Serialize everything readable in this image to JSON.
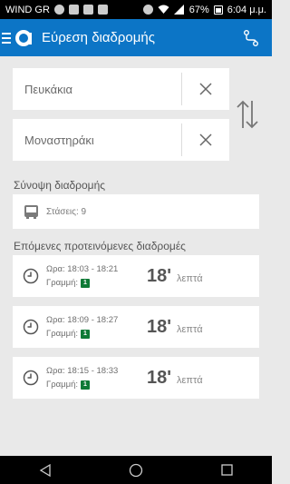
{
  "status_bar": {
    "carrier": "WIND GR",
    "battery": "67%",
    "time": "6:04 μ.μ."
  },
  "appbar": {
    "title": "Εύρεση διαδρομής"
  },
  "from_input": {
    "value": "Πευκάκια"
  },
  "to_input": {
    "value": "Μοναστηράκι"
  },
  "summary": {
    "title": "Σύνοψη διαδρομής",
    "stops": "Στάσεις: 9"
  },
  "suggested": {
    "title": "Επόμενες προτεινόμενες διαδρομές",
    "routes": [
      {
        "time": "Ωρα: 18:03 - 18:21",
        "line_label": "Γραμμή:",
        "line": "1",
        "duration": "18ʹ",
        "unit": "λεπτά"
      },
      {
        "time": "Ωρα: 18:09 - 18:27",
        "line_label": "Γραμμή:",
        "line": "1",
        "duration": "18ʹ",
        "unit": "λεπτά"
      },
      {
        "time": "Ωρα: 18:15 - 18:33",
        "line_label": "Γραμμή:",
        "line": "1",
        "duration": "18ʹ",
        "unit": "λεπτά"
      }
    ]
  },
  "colors": {
    "primary": "#0c75c6",
    "background": "#e9e9e9",
    "line_badge": "#0f7a36"
  },
  "icons": [
    "menu-icon",
    "app-logo-icon",
    "route-map-icon",
    "clear-icon",
    "swap-icon",
    "bus-icon",
    "clock-icon",
    "back-icon",
    "home-icon",
    "recents-icon"
  ]
}
